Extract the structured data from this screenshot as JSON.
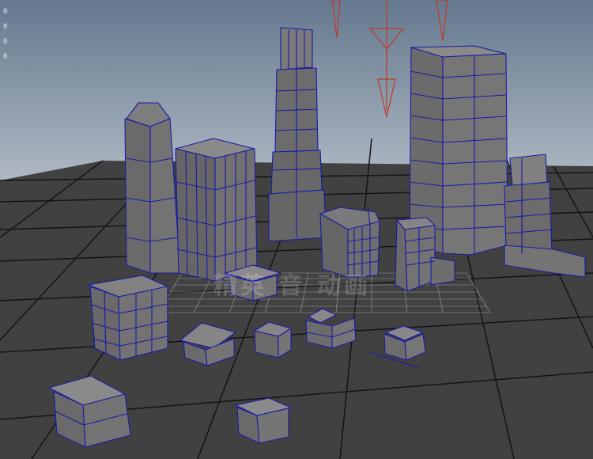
{
  "viewport": {
    "hud_values": [
      "0",
      "0",
      "0",
      "0"
    ],
    "watermark": "精英 音 动画"
  },
  "colors": {
    "sky_top": "#64788e",
    "sky_bottom": "#b3bcc6",
    "floor": "#414141",
    "grid_line": "#111111",
    "building_fill": "#6a6a6a",
    "wireframe": "#1a1aa8",
    "light_gizmo": "#c0392b",
    "center_grid": "#c8c8c8"
  },
  "icons": {
    "camera_gizmo": "directional-light-arrow-icon"
  }
}
